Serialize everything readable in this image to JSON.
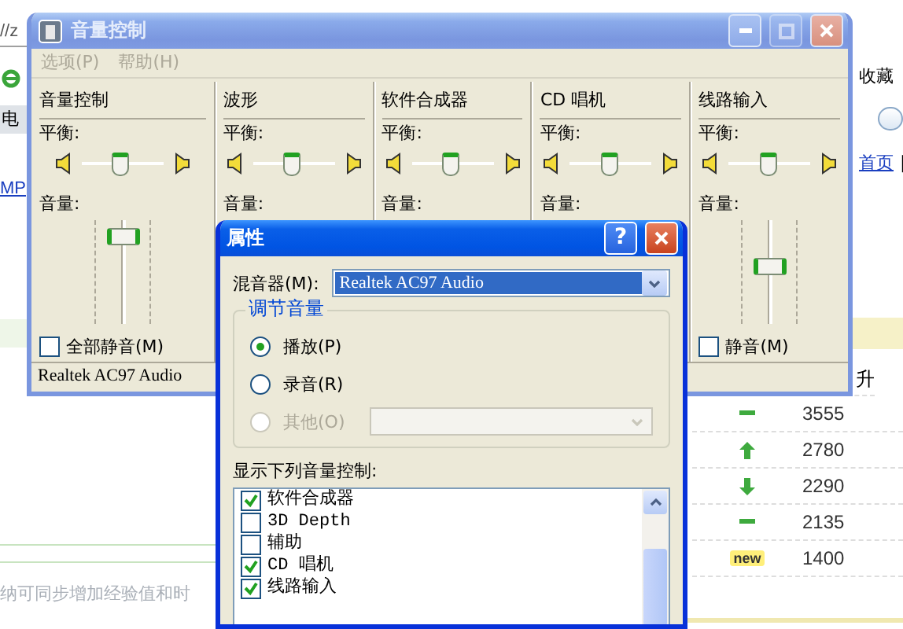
{
  "browser_page": {
    "address_text": "//z",
    "left_tab": "电",
    "left_link": "MP",
    "right_link": "收藏",
    "home_link": "首页",
    "separator": "|",
    "ranking": {
      "column_heading": "升",
      "rows": [
        {
          "kind": "same",
          "score": "3555"
        },
        {
          "kind": "up",
          "score": "2780"
        },
        {
          "kind": "down",
          "score": "2290"
        },
        {
          "kind": "same",
          "score": "2135"
        },
        {
          "kind": "new",
          "badge": "new",
          "score": "1400"
        }
      ]
    },
    "note": "纳可同步增加经验值和时"
  },
  "mixer_window": {
    "title": "音量控制",
    "active": false,
    "menu": [
      "选项(P)",
      "帮助(H)"
    ],
    "channels": [
      {
        "name": "音量控制",
        "balance_label": "平衡:",
        "balance": {
          "level": 0.5
        },
        "volume_label": "音量:",
        "volume": {
          "level": 0.9
        },
        "mute": {
          "label": "全部静音(M)",
          "checked": false
        }
      },
      {
        "name": "波形",
        "balance_label": "平衡:",
        "balance": {
          "level": 0.5
        },
        "volume_label": "音量:"
      },
      {
        "name": "软件合成器",
        "balance_label": "平衡:",
        "balance": {
          "level": 0.5
        },
        "volume_label": "音量:"
      },
      {
        "name": "CD 唱机",
        "balance_label": "平衡:",
        "balance": {
          "level": 0.5
        },
        "volume_label": "音量:"
      },
      {
        "name": "线路输入",
        "balance_label": "平衡:",
        "balance": {
          "level": 0.5
        },
        "volume_label": "音量:",
        "volume": {
          "level": 0.55
        },
        "mute": {
          "label": "静音(M)",
          "checked": false
        }
      }
    ],
    "status_bar": "Realtek AC97 Audio"
  },
  "properties_dialog": {
    "title": "属性",
    "active": true,
    "help_button": "?",
    "mixer_label": "混音器(M):",
    "mixer_value": "Realtek AC97 Audio",
    "group_title": "调节音量",
    "sources": [
      {
        "label": "播放(P)",
        "selected": true,
        "disabled": false
      },
      {
        "label": "录音(R)",
        "selected": false,
        "disabled": false
      },
      {
        "label": "其他(O)",
        "selected": false,
        "disabled": true
      }
    ],
    "controls_label": "显示下列音量控制:",
    "controls": [
      {
        "label": "软件合成器",
        "checked": true
      },
      {
        "label": "3D Depth",
        "checked": false
      },
      {
        "label": "辅助",
        "checked": false
      },
      {
        "label": "CD 唱机",
        "checked": true
      },
      {
        "label": "线路输入",
        "checked": true
      }
    ]
  }
}
